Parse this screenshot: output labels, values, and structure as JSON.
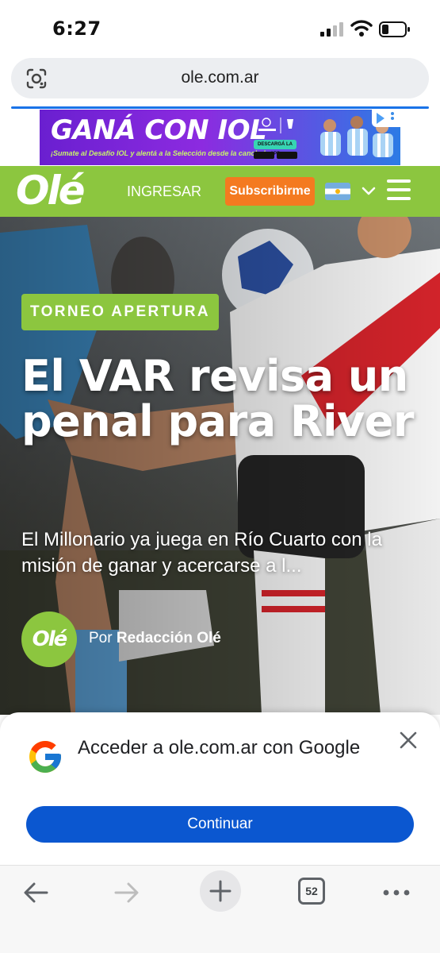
{
  "status_bar": {
    "time": "6:27"
  },
  "browser": {
    "url": "ole.com.ar",
    "tab_count": "52"
  },
  "ad": {
    "title": "GANÁ CON IOL",
    "subtitle": "¡Sumate al Desafío IOL y alentá a la Selección desde la cancha!",
    "badge": "DESCARGÁ LA APP",
    "brand_color": "#7a26d9"
  },
  "site_header": {
    "logo": "Olé",
    "login_label": "INGRESAR",
    "subscribe_label": "Subscribirme",
    "brand_color": "#8cc63f",
    "accent_color": "#f47a20"
  },
  "article": {
    "tag": "TORNEO APERTURA",
    "headline": "El VAR revisa un penal para River",
    "summary": "El Millonario ya juega en Río Cuarto con la misión de ganar y acercarse a l...",
    "author_prefix": "Por",
    "author": "Redacción Olé",
    "author_avatar": "Olé"
  },
  "google_sheet": {
    "title": "Acceder a ole.com.ar con Google",
    "continue_label": "Continuar",
    "button_color": "#0b57d0"
  },
  "icons": {
    "status": [
      "signal-icon",
      "wifi-icon",
      "battery-icon"
    ],
    "url_bar": [
      "lens-icon"
    ],
    "toolbar": [
      "back-arrow-icon",
      "forward-arrow-icon",
      "plus-icon",
      "tabs-icon",
      "more-icon"
    ]
  }
}
